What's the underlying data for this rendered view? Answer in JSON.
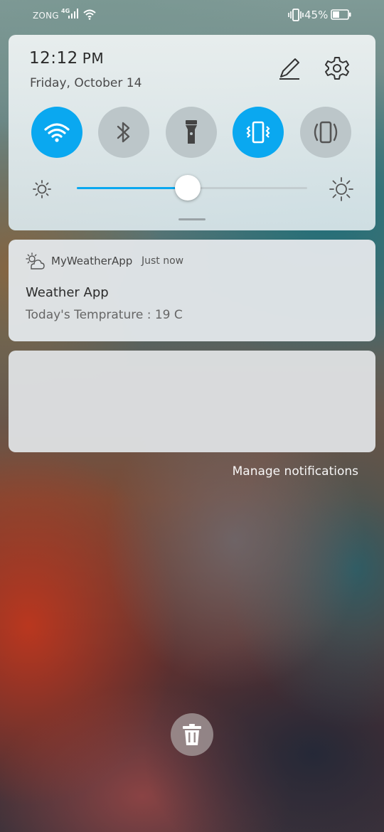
{
  "status_bar": {
    "carrier": "ZONG",
    "network_type": "4G",
    "battery_percent": "45%",
    "battery_level": 0.45
  },
  "quick_settings": {
    "time": "12:12",
    "ampm": "PM",
    "date": "Friday, October 14",
    "tiles": [
      {
        "name": "wifi",
        "icon": "wifi-icon",
        "active": true
      },
      {
        "name": "bluetooth",
        "icon": "bluetooth-icon",
        "active": false
      },
      {
        "name": "flashlight",
        "icon": "flashlight-icon",
        "active": false
      },
      {
        "name": "vibrate",
        "icon": "vibrate-icon",
        "active": true
      },
      {
        "name": "auto-rotate",
        "icon": "rotate-icon",
        "active": false
      }
    ],
    "brightness_level": 0.48,
    "accent_color": "#0aa8f0"
  },
  "notification": {
    "app_name": "MyWeatherApp",
    "time": "Just now",
    "title": "Weather App",
    "body": "Today's Temprature : 19 C"
  },
  "manage_label": "Manage notifications"
}
